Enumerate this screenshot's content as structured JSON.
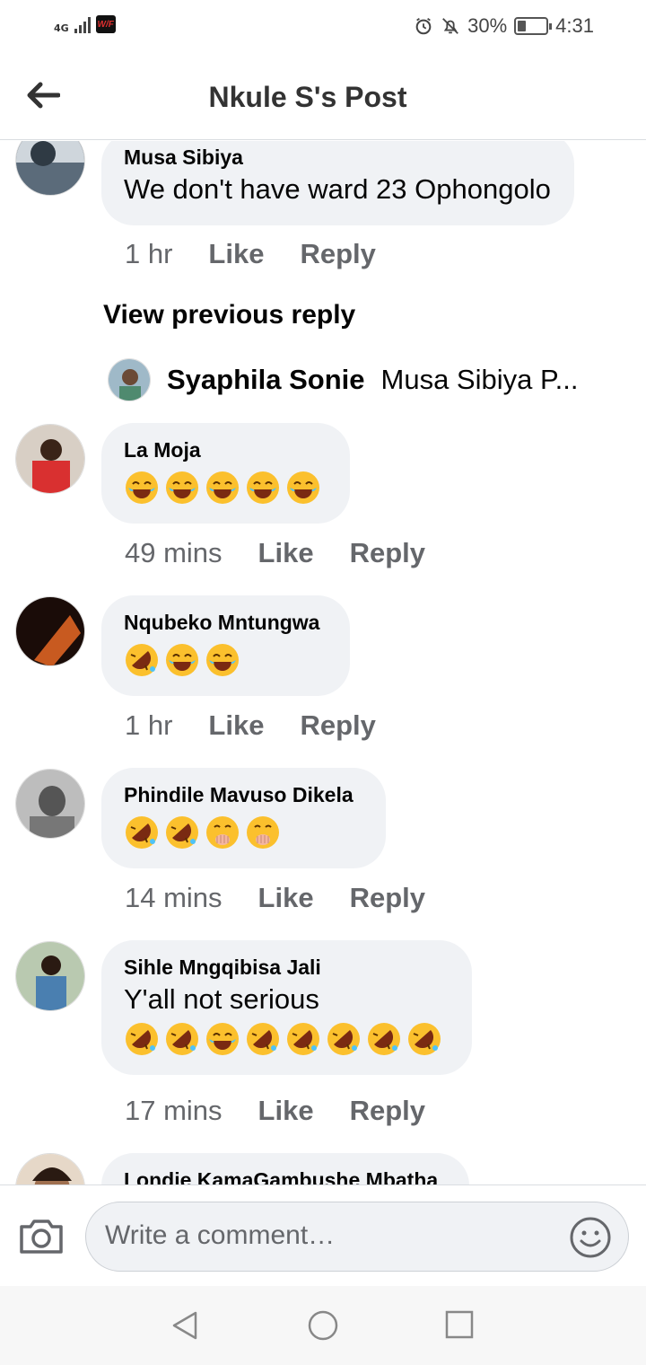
{
  "status_bar": {
    "network": "4G",
    "carrier_badge": "W/F",
    "battery": "30%",
    "battery_level": 0.3,
    "time": "4:31",
    "icons": [
      "alarm-icon",
      "mute-icon",
      "battery-icon"
    ]
  },
  "header": {
    "title": "Nkule S's Post",
    "back_icon": "arrow-left-icon"
  },
  "comments": [
    {
      "author": "Musa Sibiya",
      "text": "We don't have ward 23 Ophongolo",
      "emojis": [],
      "time": "1 hr",
      "like": "Like",
      "reply": "Reply",
      "avatar_color": "#5b6b7a"
    },
    {
      "author": "La Moja",
      "text": "",
      "emojis": [
        "face-with-tears-of-joy",
        "face-with-tears-of-joy",
        "face-with-tears-of-joy",
        "face-with-tears-of-joy",
        "face-with-tears-of-joy"
      ],
      "time": "49 mins",
      "like": "Like",
      "reply": "Reply",
      "avatar_color": "#c94040"
    },
    {
      "author": "Nqubeko Mntungwa",
      "text": "",
      "emojis": [
        "rolling-on-floor-laughing",
        "face-with-tears-of-joy",
        "face-with-tears-of-joy"
      ],
      "time": "1 hr",
      "like": "Like",
      "reply": "Reply",
      "avatar_color": "#3a2018"
    },
    {
      "author": "Phindile Mavuso Dikela",
      "text": "",
      "emojis": [
        "rolling-on-floor-laughing",
        "rolling-on-floor-laughing",
        "hugging-face",
        "hugging-face"
      ],
      "time": "14 mins",
      "like": "Like",
      "reply": "Reply",
      "avatar_color": "#8a8a8a"
    },
    {
      "author": "Sihle Mngqibisa Jali",
      "text": "Y'all not serious",
      "emojis": [
        "rolling-on-floor-laughing",
        "rolling-on-floor-laughing",
        "face-with-tears-of-joy",
        "rolling-on-floor-laughing",
        "rolling-on-floor-laughing",
        "rolling-on-floor-laughing",
        "rolling-on-floor-laughing",
        "rolling-on-floor-laughing"
      ],
      "time": "17 mins",
      "like": "Like",
      "reply": "Reply",
      "avatar_color": "#4a7fb0"
    },
    {
      "author": "Londie KamaGambushe Mbatha",
      "text": "",
      "emojis": [],
      "time": "",
      "like": "",
      "reply": "",
      "avatar_color": "#a07050"
    }
  ],
  "view_previous": "View previous reply",
  "reply_preview": {
    "author": "Syaphila Sonie",
    "text": "Musa Sibiya P..."
  },
  "composer": {
    "placeholder": "Write a comment…",
    "camera_icon": "camera-icon",
    "emoji_icon": "smiley-icon"
  },
  "nav": {
    "back": "nav-back-icon",
    "home": "nav-home-icon",
    "recents": "nav-recents-icon"
  }
}
